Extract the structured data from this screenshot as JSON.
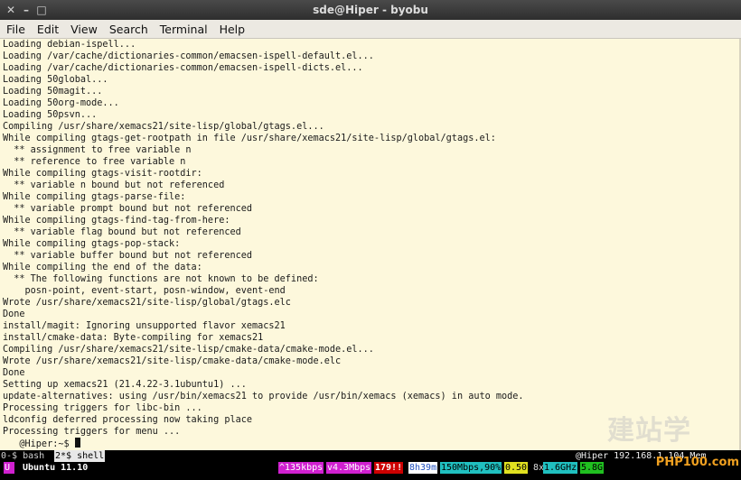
{
  "window": {
    "title": "sde@Hiper - byobu",
    "colors": {
      "background": "#fdf8dc",
      "accent_magenta": "#e020e0",
      "accent_red": "#cc0000",
      "accent_cyan": "#20c0c0"
    }
  },
  "menu": [
    "File",
    "Edit",
    "View",
    "Search",
    "Terminal",
    "Help"
  ],
  "terminal": {
    "lines": [
      "Loading debian-ispell...",
      "Loading /var/cache/dictionaries-common/emacsen-ispell-default.el...",
      "Loading /var/cache/dictionaries-common/emacsen-ispell-dicts.el...",
      "Loading 50global...",
      "Loading 50magit...",
      "Loading 50org-mode...",
      "Loading 50psvn...",
      "Compiling /usr/share/xemacs21/site-lisp/global/gtags.el...",
      "While compiling gtags-get-rootpath in file /usr/share/xemacs21/site-lisp/global/gtags.el:",
      "  ** assignment to free variable n",
      "  ** reference to free variable n",
      "While compiling gtags-visit-rootdir:",
      "  ** variable n bound but not referenced",
      "While compiling gtags-parse-file:",
      "  ** variable prompt bound but not referenced",
      "While compiling gtags-find-tag-from-here:",
      "  ** variable flag bound but not referenced",
      "While compiling gtags-pop-stack:",
      "  ** variable buffer bound but not referenced",
      "While compiling the end of the data:",
      "  ** The following functions are not known to be defined:",
      "    posn-point, event-start, posn-window, event-end",
      "Wrote /usr/share/xemacs21/site-lisp/global/gtags.elc",
      "Done",
      "install/magit: Ignoring unsupported flavor xemacs21",
      "install/cmake-data: Byte-compiling for xemacs21",
      "Compiling /usr/share/xemacs21/site-lisp/cmake-data/cmake-mode.el...",
      "Wrote /usr/share/xemacs21/site-lisp/cmake-data/cmake-mode.elc",
      "Done",
      "Setting up xemacs21 (21.4.22-3.1ubuntu1) ...",
      "update-alternatives: using /usr/bin/xemacs21 to provide /usr/bin/xemacs (xemacs) in auto mode.",
      "Processing triggers for libc-bin ...",
      "ldconfig deferred processing now taking place",
      "Processing triggers for menu ..."
    ],
    "prompt": "   @Hiper:~$ "
  },
  "tabs": [
    {
      "label": "0-$ bash",
      "active": false
    },
    {
      "label": "2*$ shell",
      "active": true
    }
  ],
  "tab_right": "@Hiper 192.168.1.104 Mem",
  "status": {
    "indicator": "U",
    "os": "Ubuntu 11.10",
    "upload": "^135kbps",
    "download": "v4.3Mbps",
    "updates": "179!!",
    "uptime": "8h39m",
    "link": "150Mbps,90%",
    "load": "0.50",
    "cpu_count": "8x",
    "cpu_freq": "1.6GHz",
    "mem": "5.8G"
  },
  "watermark": "建站学",
  "logo": "PHP100.com"
}
